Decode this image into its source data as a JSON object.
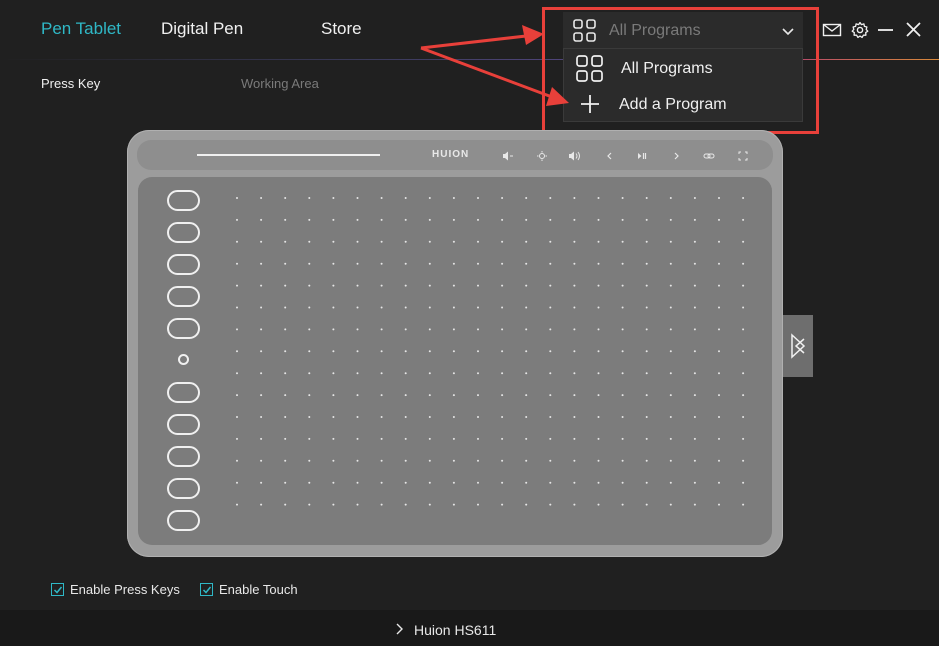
{
  "nav": {
    "tabs": [
      {
        "label": "Pen Tablet",
        "active": true
      },
      {
        "label": "Digital Pen",
        "active": false
      },
      {
        "label": "Store",
        "active": false
      }
    ],
    "icons": [
      "mail-icon",
      "gear-icon",
      "minimize-icon",
      "close-icon"
    ]
  },
  "program_select": {
    "selected": "All Programs",
    "icon": "grid-icon",
    "options": [
      {
        "label": "All Programs",
        "icon": "grid-icon"
      },
      {
        "label": "Add a Program",
        "icon": "plus-icon"
      }
    ]
  },
  "sub_tabs": [
    {
      "label": "Press Key",
      "active": true
    },
    {
      "label": "Working Area",
      "active": false
    }
  ],
  "tablet": {
    "brand": "HUION",
    "press_key_count": 10,
    "top_keys": [
      "volume-down",
      "brightness",
      "volume-up",
      "previous",
      "play-pause",
      "next",
      "link",
      "fullscreen"
    ]
  },
  "options": {
    "enable_press_keys": {
      "label": "Enable Press Keys",
      "checked": true
    },
    "enable_touch": {
      "label": "Enable Touch",
      "checked": true
    }
  },
  "device": {
    "name": "Huion HS611"
  },
  "colors": {
    "accent": "#2fb8c6",
    "highlight": "#e8403a",
    "background": "#202020"
  }
}
